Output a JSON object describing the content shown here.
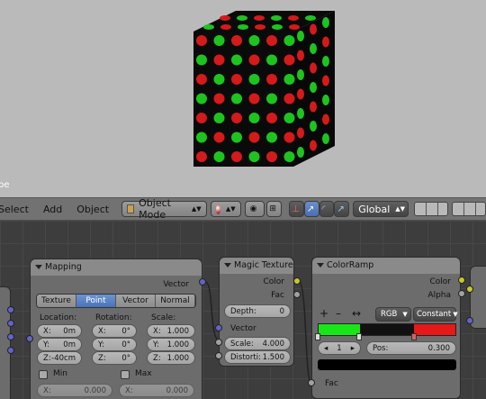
{
  "viewport": {
    "object_label": "Cube",
    "visible_label": "be"
  },
  "header": {
    "menus": [
      "Select",
      "Add",
      "Object"
    ],
    "mode": "Object Mode",
    "orientation": "Global"
  },
  "mapping_node": {
    "title": "Mapping",
    "output": "Vector",
    "types": [
      "Texture",
      "Point",
      "Vector",
      "Normal"
    ],
    "active_type": "Point",
    "location_label": "Location:",
    "rotation_label": "Rotation:",
    "scale_label": "Scale:",
    "location": [
      {
        "axis": "X:",
        "value": "0m"
      },
      {
        "axis": "Y:",
        "value": "0m"
      },
      {
        "axis": "Z:",
        "value": "-40cm"
      }
    ],
    "rotation": [
      {
        "axis": "X:",
        "value": "0°"
      },
      {
        "axis": "Y:",
        "value": "0°"
      },
      {
        "axis": "Z:",
        "value": "0°"
      }
    ],
    "scale": [
      {
        "axis": "X:",
        "value": "1.000"
      },
      {
        "axis": "Y:",
        "value": "1.000"
      },
      {
        "axis": "Z:",
        "value": "1.000"
      }
    ],
    "min_label": "Min",
    "max_label": "Max",
    "min": [
      {
        "axis": "X:",
        "value": "0.000"
      }
    ],
    "max": [
      {
        "axis": "X:",
        "value": "0.000"
      }
    ]
  },
  "magic_node": {
    "title": "Magic Texture",
    "outputs": [
      "Color",
      "Fac"
    ],
    "depth_label": "Depth:",
    "depth": "0",
    "input": "Vector",
    "scale_label": "Scale:",
    "scale": "4.000",
    "distortion_label": "Distorti:",
    "distortion": "1.500"
  },
  "ramp_node": {
    "title": "ColorRamp",
    "outputs": [
      "Color",
      "Alpha"
    ],
    "plus": "+",
    "minus": "–",
    "flip": "↔",
    "color_mode": "RGB",
    "interpolation": "Constant",
    "stop_index": "1",
    "pos_label": "Pos:",
    "pos": "0.300",
    "input": "Fac",
    "colors": {
      "green": "#19e619",
      "red": "#e61919"
    }
  },
  "cube_colors": {
    "red": "#d41a1a",
    "green": "#1ec41e",
    "body": "#0a0a0a"
  }
}
